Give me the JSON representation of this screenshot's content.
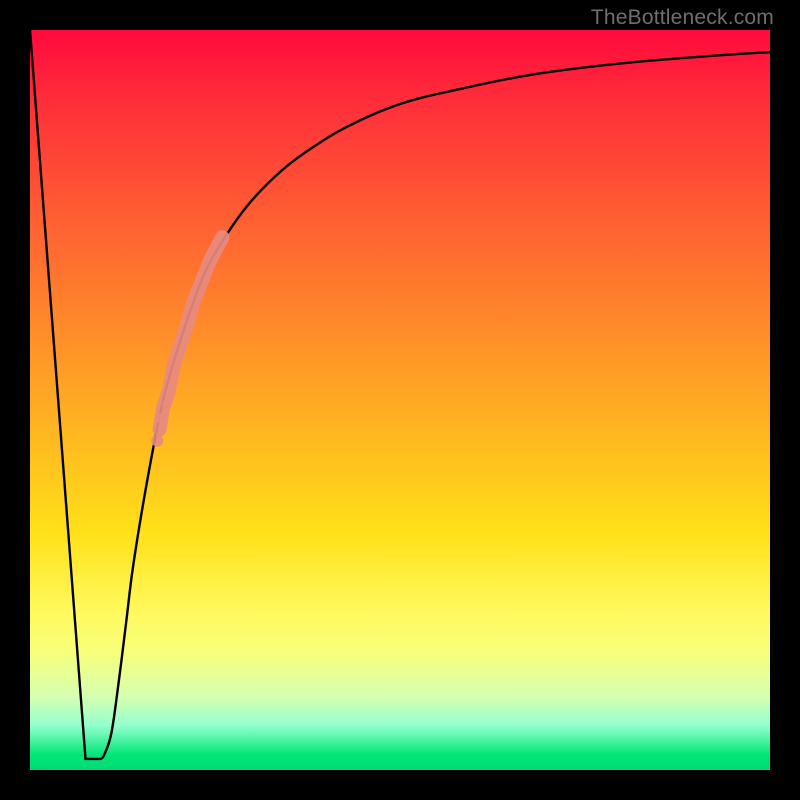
{
  "watermark": "TheBottleneck.com",
  "colors": {
    "curve": "#000000",
    "dots": "#e88a80",
    "background_frame": "#000000"
  },
  "chart_data": {
    "type": "line",
    "title": "",
    "xlabel": "",
    "ylabel": "",
    "xlim": [
      0,
      100
    ],
    "ylim": [
      0,
      100
    ],
    "grid": false,
    "legend": false,
    "background": "rainbow-gradient (red→orange→yellow→green, top→bottom)",
    "series": [
      {
        "name": "bottleneck-curve",
        "x": [
          0,
          3,
          5,
          7,
          8,
          9,
          10,
          11,
          12,
          13,
          14,
          16,
          18,
          20,
          22,
          24,
          27,
          30,
          34,
          38,
          43,
          50,
          58,
          68,
          80,
          92,
          100
        ],
        "y": [
          100,
          70,
          40,
          12,
          2,
          1.5,
          2,
          5,
          12,
          20,
          28,
          40,
          50,
          57,
          63,
          68,
          73,
          77,
          81,
          84,
          87,
          90,
          92,
          94,
          95.5,
          96.5,
          97
        ]
      }
    ],
    "scatter_overlay": {
      "name": "highlight-dots",
      "color": "#e88a80",
      "points": [
        {
          "x": 17.5,
          "y": 46
        },
        {
          "x": 18.0,
          "y": 49
        },
        {
          "x": 18.7,
          "y": 51
        },
        {
          "x": 19.5,
          "y": 55
        },
        {
          "x": 20.5,
          "y": 58
        },
        {
          "x": 21.2,
          "y": 60
        },
        {
          "x": 22.0,
          "y": 63
        },
        {
          "x": 22.8,
          "y": 65
        },
        {
          "x": 23.6,
          "y": 67
        },
        {
          "x": 24.4,
          "y": 69
        },
        {
          "x": 25.2,
          "y": 70.5
        },
        {
          "x": 26.0,
          "y": 72
        }
      ]
    },
    "notch": {
      "x_range": [
        7.5,
        9.5
      ],
      "y": 1.5,
      "description": "flat minimum at bottom of V"
    }
  }
}
